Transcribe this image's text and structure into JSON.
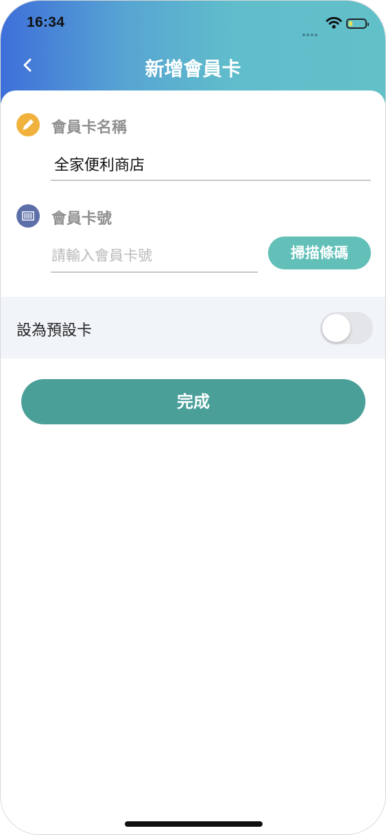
{
  "status_bar": {
    "time": "16:34",
    "wifi_icon": "wifi-icon",
    "battery_icon": "battery-icon"
  },
  "header": {
    "title": "新增會員卡",
    "back_icon": "chevron-left-icon",
    "gradient": [
      "#3e6fd9",
      "#62c0c9"
    ]
  },
  "form": {
    "name_section": {
      "icon": "pencil-icon",
      "icon_color": "#f0b23c",
      "label": "會員卡名稱",
      "value": "全家便利商店"
    },
    "number_section": {
      "icon": "barcode-icon",
      "icon_color": "#5d6fa8",
      "label": "會員卡號",
      "placeholder": "請輸入會員卡號",
      "value": "",
      "scan_button_label": "掃描條碼",
      "scan_button_color": "#62c0b9"
    }
  },
  "default_setting": {
    "label": "設為預設卡",
    "toggle_on": false
  },
  "actions": {
    "done_label": "完成",
    "done_color": "#4a9f99"
  }
}
